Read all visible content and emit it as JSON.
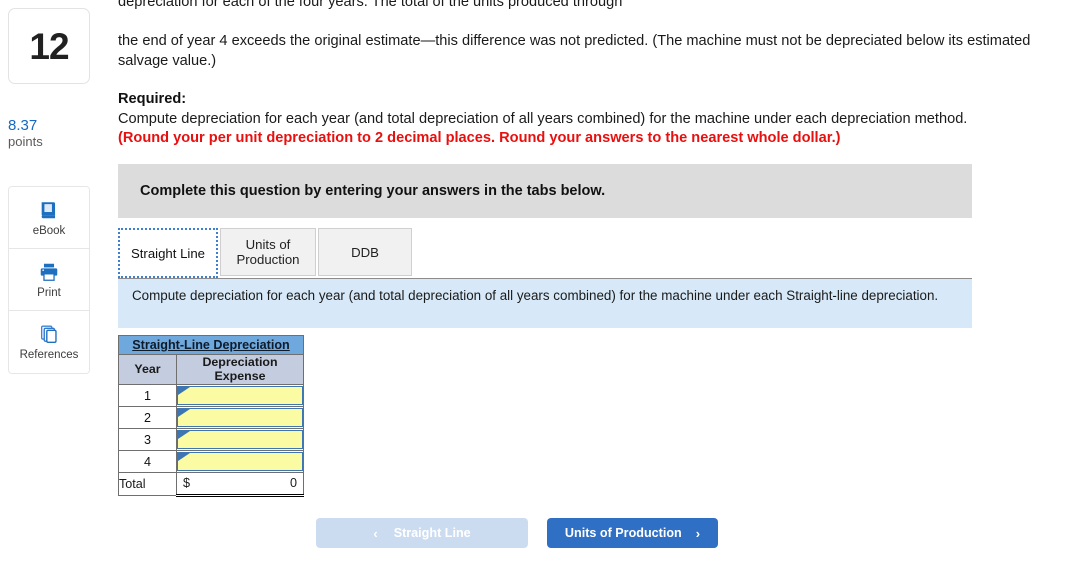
{
  "sidebar": {
    "question_number": "12",
    "points_value": "8.37",
    "points_label": "points",
    "tools": [
      {
        "label": "eBook",
        "icon": "book-icon"
      },
      {
        "label": "Print",
        "icon": "printer-icon"
      },
      {
        "label": "References",
        "icon": "pages-stack-icon"
      }
    ]
  },
  "main": {
    "clipped_line": "depreciation for each of the four years. The total of the units produced through",
    "paragraph": "the end of year 4 exceeds the original estimate—this difference was not predicted. (The machine must not be depreciated below its estimated salvage value.)",
    "required_title": "Required:",
    "required_line": "Compute depreciation for each year (and total depreciation of all years combined) for the machine under each depreciation method.",
    "required_round": "(Round your per unit depreciation to 2 decimal places. Round your answers to the nearest whole dollar.)",
    "banner_text": "Complete this question by entering your answers in the tabs below.",
    "tabs": [
      {
        "label": "Straight Line",
        "active": true
      },
      {
        "label": "Units of Production",
        "active": false
      },
      {
        "label": "DDB",
        "active": false
      }
    ],
    "instruction": "Compute depreciation for each year (and total depreciation of all years combined) for the machine under each Straight-line depreciation."
  },
  "table": {
    "title": "Straight-Line Depreciation",
    "headers": [
      "Year",
      "Depreciation Expense"
    ],
    "rows": [
      {
        "year": "1",
        "value": ""
      },
      {
        "year": "2",
        "value": ""
      },
      {
        "year": "3",
        "value": ""
      },
      {
        "year": "4",
        "value": ""
      }
    ],
    "total_label": "Total",
    "total_currency": "$",
    "total_value": "0"
  },
  "nav": {
    "prev_label": "Straight Line",
    "prev_chevron": "‹",
    "next_label": "Units of Production",
    "next_chevron": "›"
  },
  "colors": {
    "accent_blue": "#2f6fc4",
    "points_blue": "#1668c1",
    "warning_red": "#e8100f",
    "table_title_bg": "#6fa8dc",
    "table_head_bg": "#c3cddf",
    "input_yellow": "#fbfba4",
    "input_border": "#3e76b3",
    "banner_gray": "#dcdcdc",
    "instruction_blue": "#d7e9f8"
  }
}
